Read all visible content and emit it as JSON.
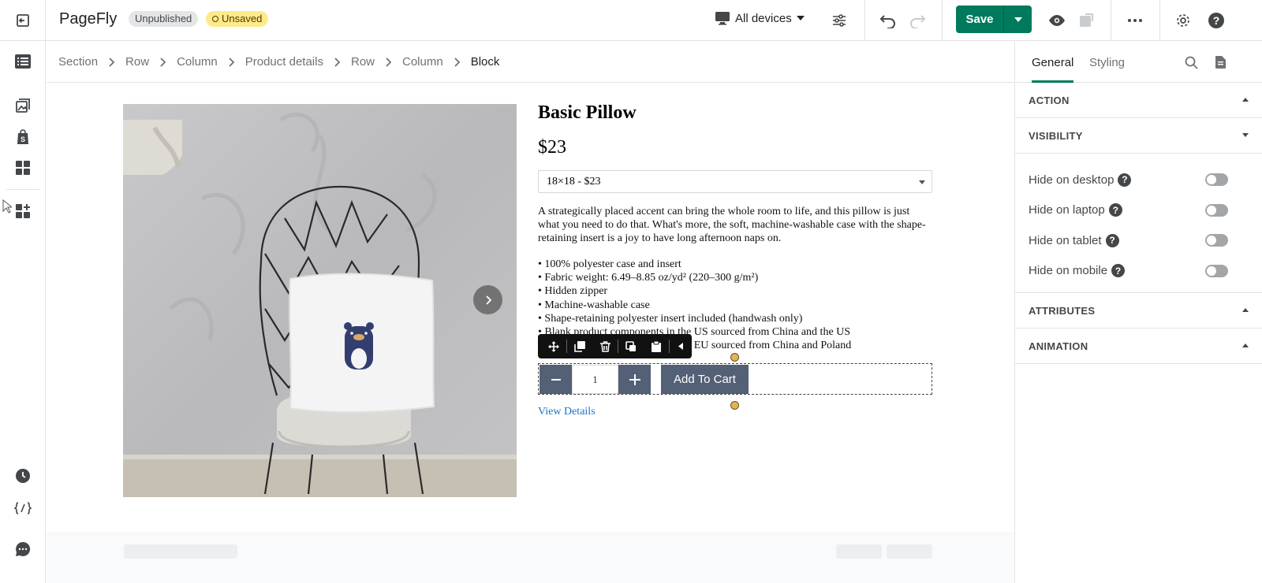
{
  "app": {
    "title": "PageFly",
    "status_published": "Unpublished",
    "status_saved": "Unsaved",
    "device_label": "All devices",
    "save_label": "Save",
    "accent_color": "#007a5c"
  },
  "breadcrumb": [
    "Section",
    "Row",
    "Column",
    "Product details",
    "Row",
    "Column",
    "Block"
  ],
  "product": {
    "title": "Basic Pillow",
    "price": "$23",
    "variant_selected": "18×18 - $23",
    "description": "A strategically placed accent can bring the whole room to life, and this pillow is just what you need to do that. What's more, the soft, machine-washable case with the shape-retaining insert is a joy to have long afternoon naps on.",
    "bullets": [
      "• 100% polyester case and insert",
      "• Fabric weight: 6.49–8.85 oz/yd² (220–300 g/m²)",
      "• Hidden zipper",
      "• Machine-washable case",
      "• Shape-retaining polyester insert included (handwash only)",
      "• Blank product components in the US sourced from China and the US",
      "• Blank product components in the EU sourced from China and Poland"
    ],
    "quantity": "1",
    "add_to_cart_label": "Add To Cart",
    "view_details_label": "View Details"
  },
  "inspector": {
    "tabs": [
      "General",
      "Styling"
    ],
    "sections": {
      "action": "ACTION",
      "visibility": "VISIBILITY",
      "attributes": "ATTRIBUTES",
      "animation": "ANIMATION"
    },
    "visibility_options": [
      {
        "label": "Hide on desktop",
        "enabled": false
      },
      {
        "label": "Hide on laptop",
        "enabled": false
      },
      {
        "label": "Hide on tablet",
        "enabled": false
      },
      {
        "label": "Hide on mobile",
        "enabled": false
      }
    ],
    "help_glyph": "?"
  }
}
